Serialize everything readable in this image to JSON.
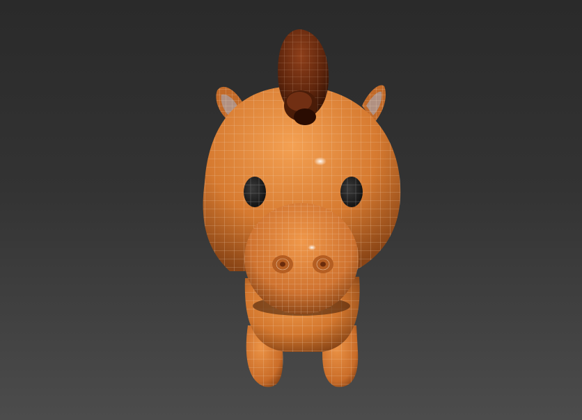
{
  "viewport": {
    "shading": "smooth-highlights-with-edged-faces",
    "model": "cartoon-horse",
    "colors": {
      "background_top": "#2a2a2a",
      "background_bottom": "#4c4c4c",
      "body": "#d3772e",
      "body_dark": "#8a4516",
      "mane": "#6a2c10",
      "mane_dark": "#3a1606",
      "eye": "#222222",
      "wire": "#e8c9a8"
    }
  }
}
